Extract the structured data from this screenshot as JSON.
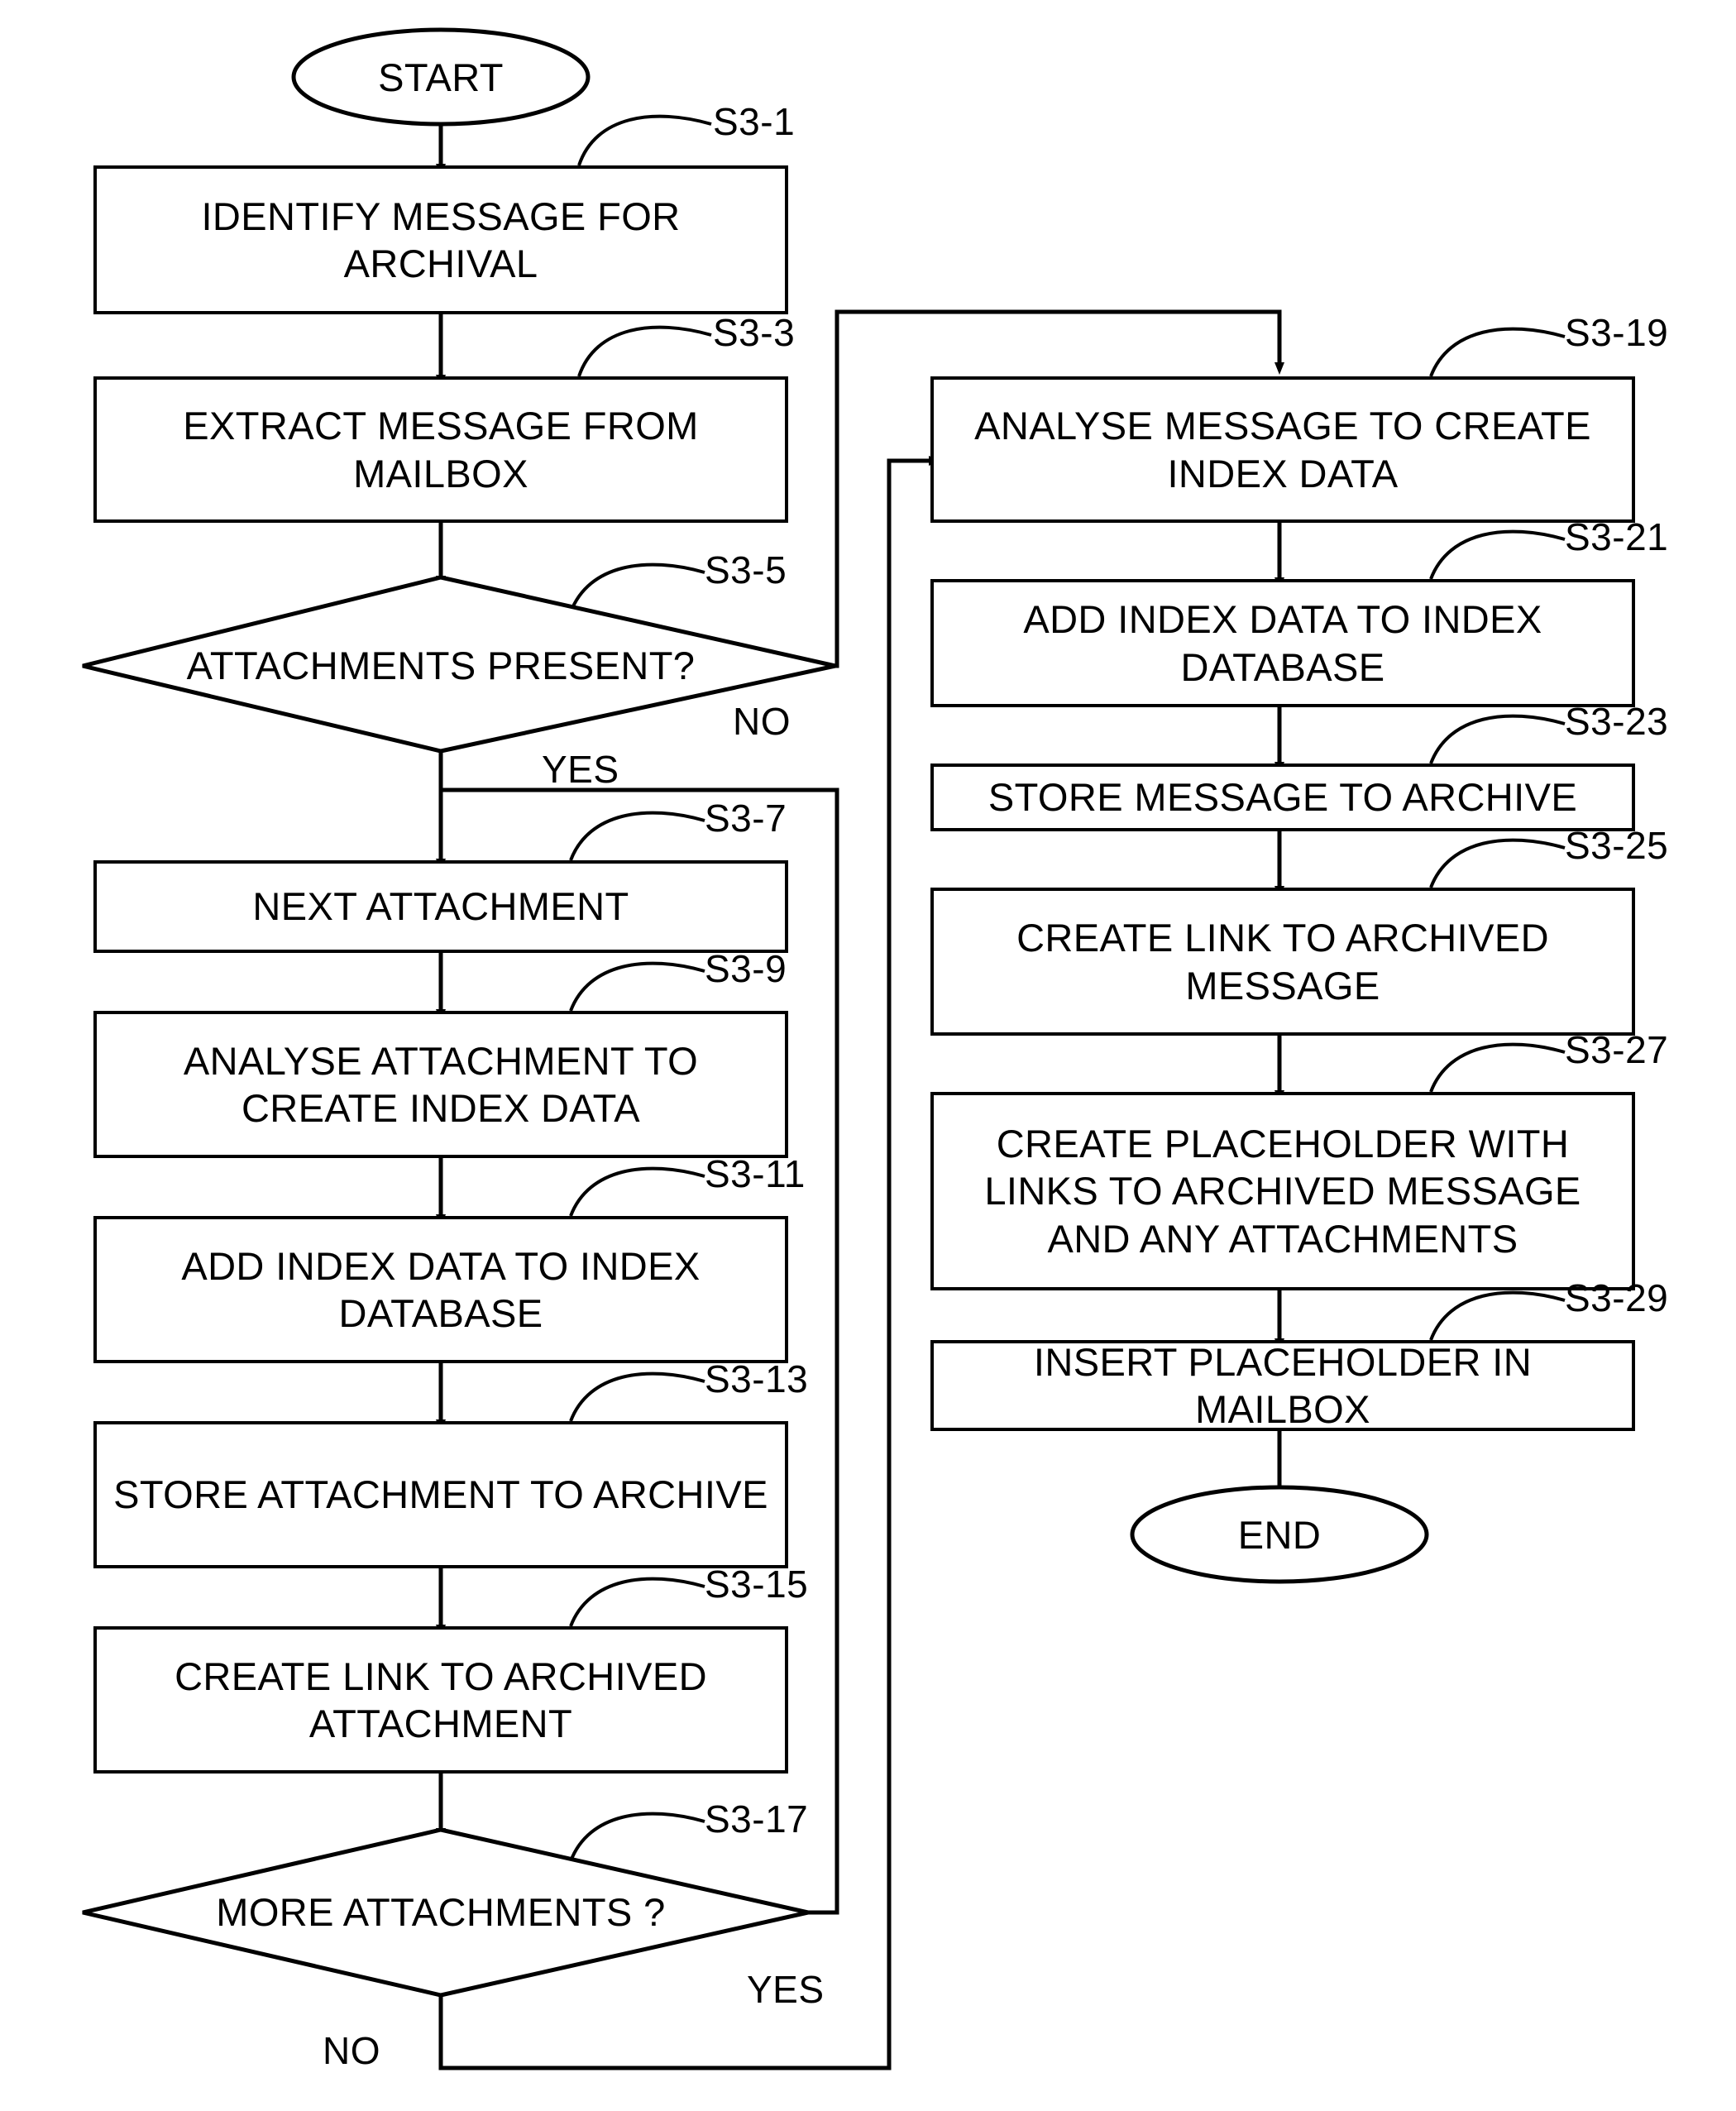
{
  "diagram": {
    "type": "flowchart",
    "title": "Message archival process flowchart",
    "terminators": {
      "start": "START",
      "end": "END"
    },
    "nodes": [
      {
        "id": "S3-1",
        "tag": "S3-1",
        "shape": "process",
        "text": "IDENTIFY MESSAGE FOR ARCHIVAL"
      },
      {
        "id": "S3-3",
        "tag": "S3-3",
        "shape": "process",
        "text": "EXTRACT MESSAGE FROM MAILBOX"
      },
      {
        "id": "S3-5",
        "tag": "S3-5",
        "shape": "decision",
        "text": "ATTACHMENTS PRESENT?"
      },
      {
        "id": "S3-7",
        "tag": "S3-7",
        "shape": "process",
        "text": "NEXT ATTACHMENT"
      },
      {
        "id": "S3-9",
        "tag": "S3-9",
        "shape": "process",
        "text": "ANALYSE ATTACHMENT TO CREATE INDEX DATA"
      },
      {
        "id": "S3-11",
        "tag": "S3-11",
        "shape": "process",
        "text": "ADD INDEX DATA TO INDEX DATABASE"
      },
      {
        "id": "S3-13",
        "tag": "S3-13",
        "shape": "process",
        "text": "STORE ATTACHMENT TO ARCHIVE"
      },
      {
        "id": "S3-15",
        "tag": "S3-15",
        "shape": "process",
        "text": "CREATE LINK TO ARCHIVED ATTACHMENT"
      },
      {
        "id": "S3-17",
        "tag": "S3-17",
        "shape": "decision",
        "text": "MORE ATTACHMENTS ?"
      },
      {
        "id": "S3-19",
        "tag": "S3-19",
        "shape": "process",
        "text": "ANALYSE MESSAGE TO CREATE INDEX DATA"
      },
      {
        "id": "S3-21",
        "tag": "S3-21",
        "shape": "process",
        "text": "ADD INDEX DATA TO INDEX DATABASE"
      },
      {
        "id": "S3-23",
        "tag": "S3-23",
        "shape": "process",
        "text": "STORE MESSAGE TO ARCHIVE"
      },
      {
        "id": "S3-25",
        "tag": "S3-25",
        "shape": "process",
        "text": "CREATE  LINK TO ARCHIVED MESSAGE"
      },
      {
        "id": "S3-27",
        "tag": "S3-27",
        "shape": "process",
        "text": "CREATE PLACEHOLDER WITH LINKS TO ARCHIVED MESSAGE AND ANY ATTACHMENTS"
      },
      {
        "id": "S3-29",
        "tag": "S3-29",
        "shape": "process",
        "text": "INSERT PLACEHOLDER IN MAILBOX"
      }
    ],
    "edge_labels": {
      "s3_5_no": "NO",
      "s3_5_yes": "YES",
      "s3_17_yes": "YES",
      "s3_17_no": "NO"
    },
    "colors": {
      "stroke": "#000000",
      "background": "#ffffff",
      "text": "#000000"
    }
  }
}
